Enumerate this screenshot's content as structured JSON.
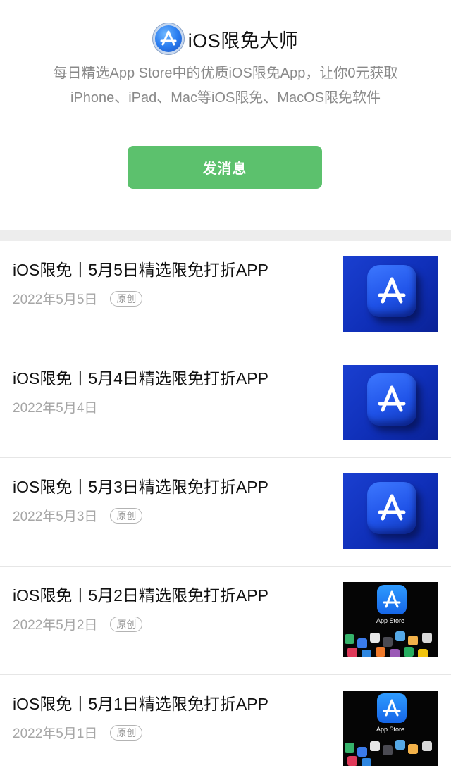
{
  "profile": {
    "name": "iOS限免大师",
    "description_line1": "每日精选App Store中的优质iOS限免App，让你0元获取",
    "description_line2": "iPhone、iPad、Mac等iOS限免、MacOS限免软件",
    "send_button": "发消息",
    "logo_icon": "app-store-icon"
  },
  "articles": [
    {
      "title": "iOS限免丨5月5日精选限免打折APP",
      "date": "2022年5月5日",
      "badge": "原创",
      "thumbnail": "blue-app-store-3d"
    },
    {
      "title": "iOS限免丨5月4日精选限免打折APP",
      "date": "2022年5月4日",
      "badge": "",
      "thumbnail": "blue-app-store-3d"
    },
    {
      "title": "iOS限免丨5月3日精选限免打折APP",
      "date": "2022年5月3日",
      "badge": "原创",
      "thumbnail": "blue-app-store-3d"
    },
    {
      "title": "iOS限免丨5月2日精选限免打折APP",
      "date": "2022年5月2日",
      "badge": "原创",
      "thumbnail": "app-store-icons-dark"
    },
    {
      "title": "iOS限免丨5月1日精选限免打折APP",
      "date": "2022年5月1日",
      "badge": "原创",
      "thumbnail": "app-store-icons-dark"
    }
  ],
  "thumb_label": "App Store",
  "colors": {
    "button": "#5cc16d",
    "band": "#ededed",
    "meta": "#a6a6a6"
  }
}
